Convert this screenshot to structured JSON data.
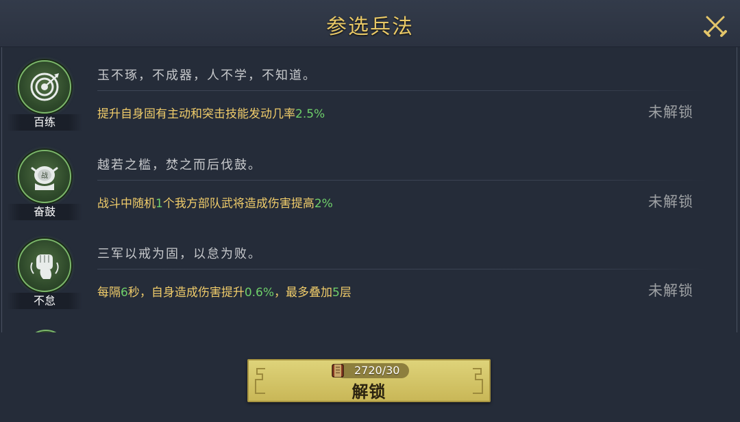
{
  "header": {
    "title": "参选兵法"
  },
  "close_icon": "close-icon (crossed swords)",
  "skills": [
    {
      "name": "百练",
      "icon": "target-icon",
      "quote": "玉不琢，不成器，人不学，不知道。",
      "effect_parts": [
        {
          "text": "提升自身固有主动和突击技能发动几率",
          "hl": false
        },
        {
          "text": "2.5%",
          "hl": true
        }
      ],
      "status": "未解锁"
    },
    {
      "name": "奋鼓",
      "icon": "war-drum-icon",
      "quote": "越若之槛，焚之而后伐鼓。",
      "effect_parts": [
        {
          "text": "战斗中随机",
          "hl": false
        },
        {
          "text": "1",
          "hl": true
        },
        {
          "text": "个我方部队武将造成伤害提高",
          "hl": false
        },
        {
          "text": "2%",
          "hl": true
        }
      ],
      "status": "未解锁"
    },
    {
      "name": "不怠",
      "icon": "fist-icon",
      "quote": "三军以戒为固，以怠为败。",
      "effect_parts": [
        {
          "text": "每隔",
          "hl": false
        },
        {
          "text": "6",
          "hl": true
        },
        {
          "text": "秒，自身造成伤害提升",
          "hl": false
        },
        {
          "text": "0.6%",
          "hl": true
        },
        {
          "text": "，最多叠加",
          "hl": false
        },
        {
          "text": "5",
          "hl": true
        },
        {
          "text": "层",
          "hl": false
        }
      ],
      "status": "未解锁"
    }
  ],
  "unlock": {
    "cost": "2720/30",
    "label": "解锁",
    "cost_icon": "book-scroll-icon"
  },
  "colors": {
    "background": "#252c39",
    "title": "#e8c867",
    "effect_text": "#f0cc6a",
    "highlight": "#6fd06a",
    "status": "#9ea1a4",
    "button": "#d6c96c"
  }
}
